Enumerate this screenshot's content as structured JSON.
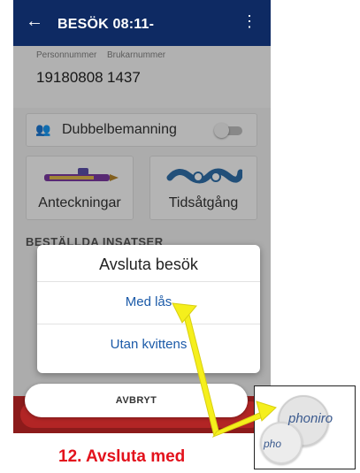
{
  "appbar": {
    "back_icon": "arrow-left-icon",
    "title": "BESÖK 08:11-",
    "menu_icon": "more-vert-icon"
  },
  "ids": {
    "personnummer_label": "Personnummer",
    "personnummer_value": "19180808",
    "brukarnummer_label": "Brukarnummer",
    "brukarnummer_value": "1437"
  },
  "dubbel": {
    "icon": "people-icon",
    "label": "Dubbelbemanning",
    "toggle_on": false
  },
  "cards": {
    "anteckningar": "Anteckningar",
    "tidsatgang": "Tidsåtgång"
  },
  "section_title": "BESTÄLLDA INSATSER",
  "dialog": {
    "title": "Avsluta besök",
    "option_1": "Med lås",
    "option_2": "Utan kvittens"
  },
  "cancel_label": "AVBRYT",
  "caption": "12. Avsluta med",
  "inset": {
    "brand": "phoniro",
    "brand_small": "pho"
  },
  "colors": {
    "appbar": "#0e2a63",
    "accent_text": "#1b5aa8",
    "caption": "#e3121c",
    "arrow": "#f5ef1c",
    "bottom_button": "#b22525"
  }
}
